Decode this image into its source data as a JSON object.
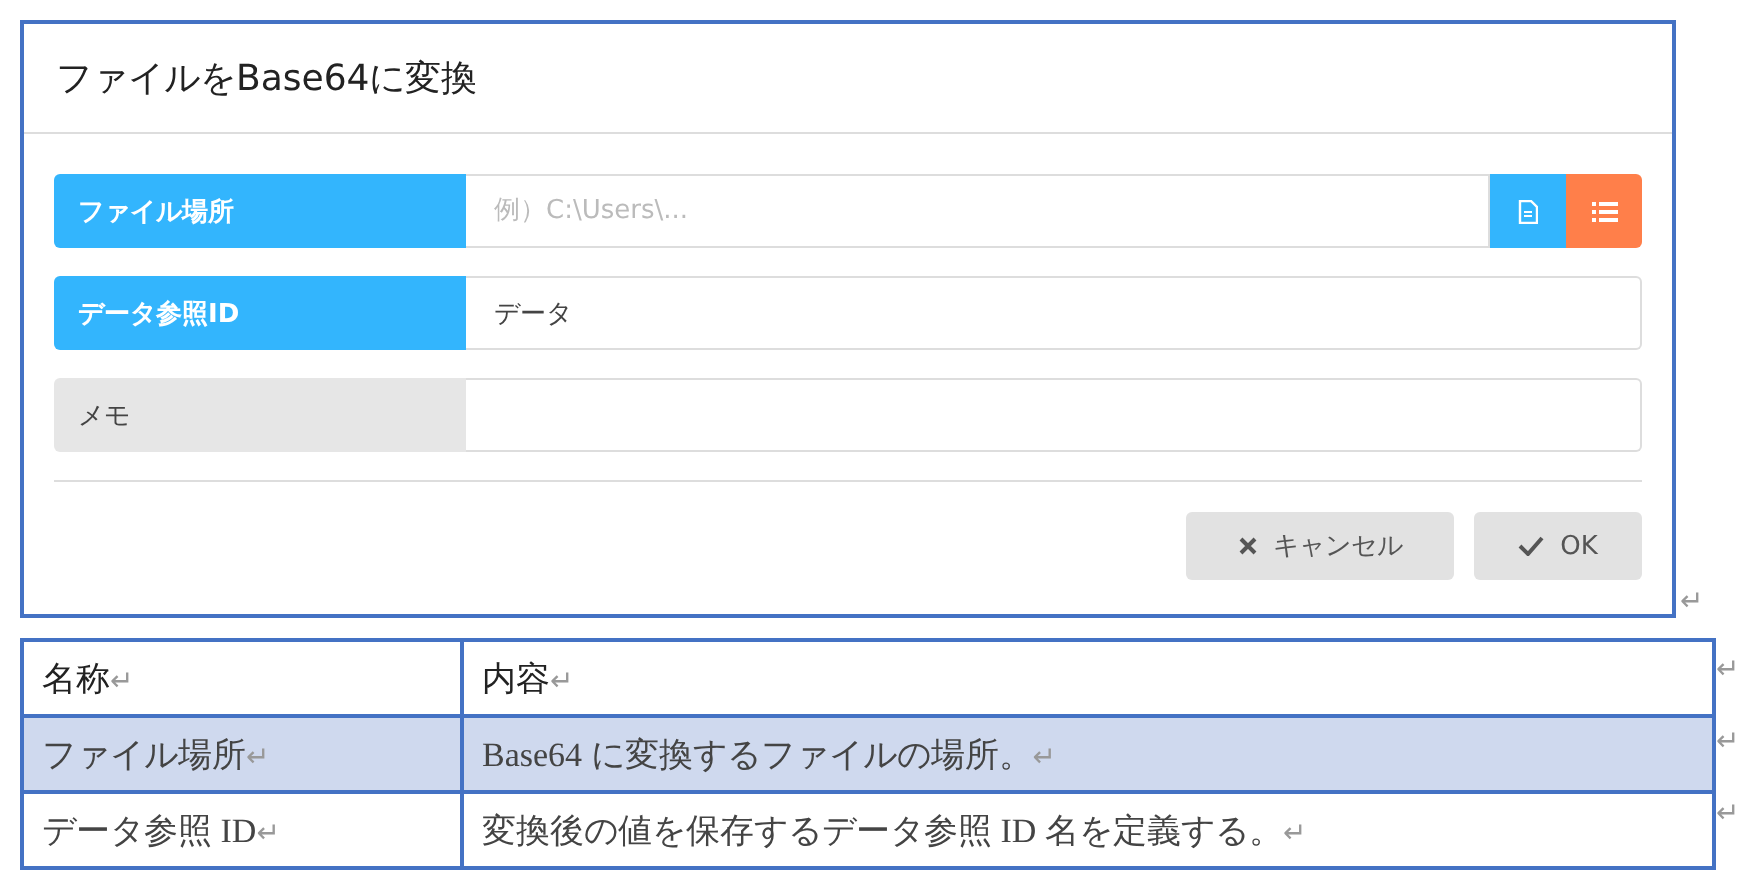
{
  "dialog": {
    "title": "ファイルをBase64に変換",
    "fields": [
      {
        "label": "ファイル場所",
        "required": true,
        "placeholder": "例）C:\\Users\\...",
        "kind": "file"
      },
      {
        "label": "データ参照ID",
        "required": true,
        "value": "データ",
        "kind": "text"
      },
      {
        "label": "メモ",
        "required": false,
        "kind": "text"
      }
    ],
    "buttons": [
      {
        "label": "キャンセル",
        "kind": "cancel"
      },
      {
        "label": "OK",
        "kind": "ok"
      }
    ],
    "end_mark": "↵"
  },
  "table": {
    "columns": [
      {
        "label": "名称",
        "end_mark": "↵"
      },
      {
        "label": "内容",
        "end_mark": "↵"
      }
    ],
    "header_end_mark": "↵",
    "rows": [
      {
        "highlighted": true,
        "cells": [
          {
            "text": "ファイル場所",
            "end_mark": "↵"
          },
          {
            "text": "Base64 に変換するファイルの場所。",
            "end_mark": "↵"
          }
        ],
        "end_mark": "↵"
      },
      {
        "highlighted": false,
        "cells": [
          {
            "text": "データ参照 ID",
            "end_mark": "↵"
          },
          {
            "text": "変換後の値を保存するデータ参照 ID 名を定義する。",
            "end_mark": "↵"
          }
        ],
        "end_mark": "↵"
      }
    ]
  }
}
